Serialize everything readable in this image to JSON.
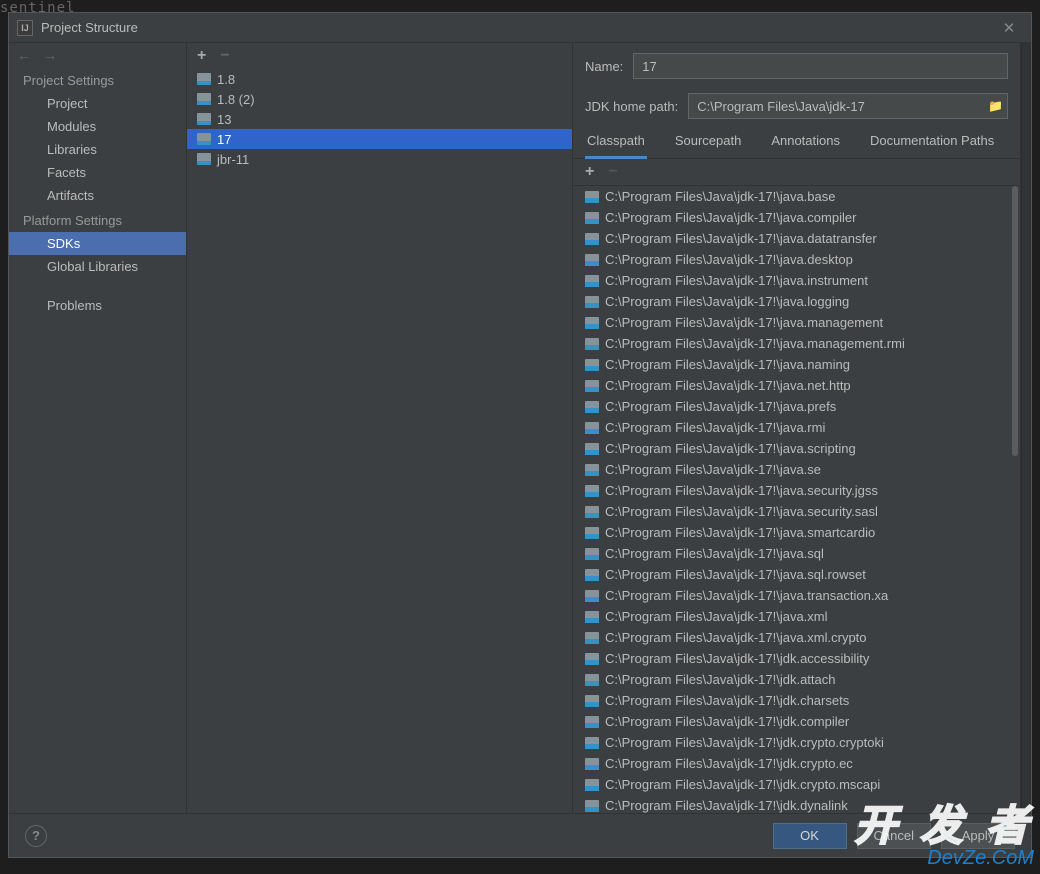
{
  "bg_top_text": "sentinel",
  "dialog": {
    "title": "Project Structure"
  },
  "nav": {
    "project_settings_header": "Project Settings",
    "project_settings_items": [
      "Project",
      "Modules",
      "Libraries",
      "Facets",
      "Artifacts"
    ],
    "platform_settings_header": "Platform Settings",
    "platform_settings_items": [
      "SDKs",
      "Global Libraries"
    ],
    "problems_item": "Problems",
    "selected": "SDKs"
  },
  "sdks": {
    "items": [
      "1.8",
      "1.8 (2)",
      "13",
      "17",
      "jbr-11"
    ],
    "selected": "17"
  },
  "form": {
    "name_label": "Name:",
    "name_value": "17",
    "path_label": "JDK home path:",
    "path_value": "C:\\Program Files\\Java\\jdk-17"
  },
  "tabs": {
    "items": [
      "Classpath",
      "Sourcepath",
      "Annotations",
      "Documentation Paths"
    ],
    "active": "Classpath"
  },
  "classpath": [
    "C:\\Program Files\\Java\\jdk-17!\\java.base",
    "C:\\Program Files\\Java\\jdk-17!\\java.compiler",
    "C:\\Program Files\\Java\\jdk-17!\\java.datatransfer",
    "C:\\Program Files\\Java\\jdk-17!\\java.desktop",
    "C:\\Program Files\\Java\\jdk-17!\\java.instrument",
    "C:\\Program Files\\Java\\jdk-17!\\java.logging",
    "C:\\Program Files\\Java\\jdk-17!\\java.management",
    "C:\\Program Files\\Java\\jdk-17!\\java.management.rmi",
    "C:\\Program Files\\Java\\jdk-17!\\java.naming",
    "C:\\Program Files\\Java\\jdk-17!\\java.net.http",
    "C:\\Program Files\\Java\\jdk-17!\\java.prefs",
    "C:\\Program Files\\Java\\jdk-17!\\java.rmi",
    "C:\\Program Files\\Java\\jdk-17!\\java.scripting",
    "C:\\Program Files\\Java\\jdk-17!\\java.se",
    "C:\\Program Files\\Java\\jdk-17!\\java.security.jgss",
    "C:\\Program Files\\Java\\jdk-17!\\java.security.sasl",
    "C:\\Program Files\\Java\\jdk-17!\\java.smartcardio",
    "C:\\Program Files\\Java\\jdk-17!\\java.sql",
    "C:\\Program Files\\Java\\jdk-17!\\java.sql.rowset",
    "C:\\Program Files\\Java\\jdk-17!\\java.transaction.xa",
    "C:\\Program Files\\Java\\jdk-17!\\java.xml",
    "C:\\Program Files\\Java\\jdk-17!\\java.xml.crypto",
    "C:\\Program Files\\Java\\jdk-17!\\jdk.accessibility",
    "C:\\Program Files\\Java\\jdk-17!\\jdk.attach",
    "C:\\Program Files\\Java\\jdk-17!\\jdk.charsets",
    "C:\\Program Files\\Java\\jdk-17!\\jdk.compiler",
    "C:\\Program Files\\Java\\jdk-17!\\jdk.crypto.cryptoki",
    "C:\\Program Files\\Java\\jdk-17!\\jdk.crypto.ec",
    "C:\\Program Files\\Java\\jdk-17!\\jdk.crypto.mscapi",
    "C:\\Program Files\\Java\\jdk-17!\\jdk.dynalink"
  ],
  "footer": {
    "ok": "OK",
    "cancel": "Cancel",
    "apply": "Apply"
  },
  "watermark": {
    "line1": "开 发 者",
    "line2": "DevZe.CoM"
  }
}
